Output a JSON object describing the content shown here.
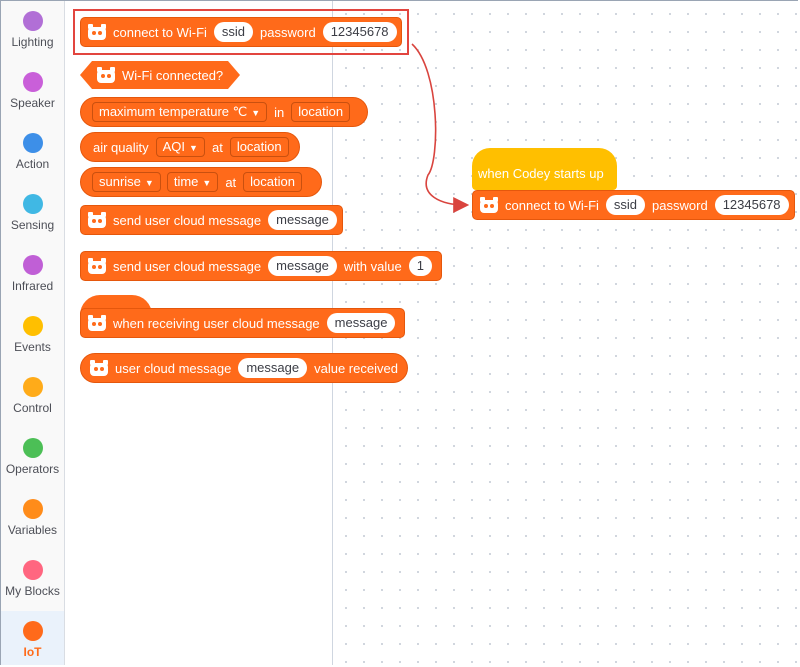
{
  "sidebar": {
    "categories": [
      {
        "label": "Lighting",
        "color": "#b16fd6"
      },
      {
        "label": "Speaker",
        "color": "#c95fd9"
      },
      {
        "label": "Action",
        "color": "#3d8fe8"
      },
      {
        "label": "Sensing",
        "color": "#40b8e4"
      },
      {
        "label": "Infrared",
        "color": "#c05fd6"
      },
      {
        "label": "Events",
        "color": "#ffbf00"
      },
      {
        "label": "Control",
        "color": "#ffab19"
      },
      {
        "label": "Operators",
        "color": "#4cbf56"
      },
      {
        "label": "Variables",
        "color": "#ff8c1a"
      },
      {
        "label": "My Blocks",
        "color": "#ff6680"
      },
      {
        "label": "IoT",
        "color": "#ff6a1a",
        "active": true
      }
    ]
  },
  "palette": {
    "connect_wifi": {
      "text1": "connect to Wi-Fi",
      "ssid": "ssid",
      "text2": "password",
      "password": "12345678"
    },
    "wifi_connected": {
      "text": "Wi-Fi connected?"
    },
    "max_temp": {
      "dropdown": "maximum temperature ℃",
      "text": "in",
      "field": "location"
    },
    "air_quality": {
      "text1": "air quality",
      "dropdown": "AQI",
      "text2": "at",
      "field": "location"
    },
    "sunrise": {
      "dropdown1": "sunrise",
      "dropdown2": "time",
      "text": "at",
      "field": "location"
    },
    "send_message": {
      "text": "send user cloud message",
      "arg": "message"
    },
    "send_message_value": {
      "text1": "send user cloud message",
      "arg": "message",
      "text2": "with value",
      "value": "1"
    },
    "when_receiving": {
      "text": "when receiving user cloud message",
      "arg": "message"
    },
    "message_value": {
      "text1": "user cloud message",
      "arg": "message",
      "text2": "value received"
    }
  },
  "workspace": {
    "hat": {
      "text": "when Codey starts up"
    },
    "connect_wifi": {
      "text1": "connect to Wi-Fi",
      "ssid": "ssid",
      "text2": "password",
      "password": "12345678"
    }
  },
  "colors": {
    "block": "#ff6a1a",
    "hat": "#ffbf00",
    "highlight": "#e2453f"
  }
}
